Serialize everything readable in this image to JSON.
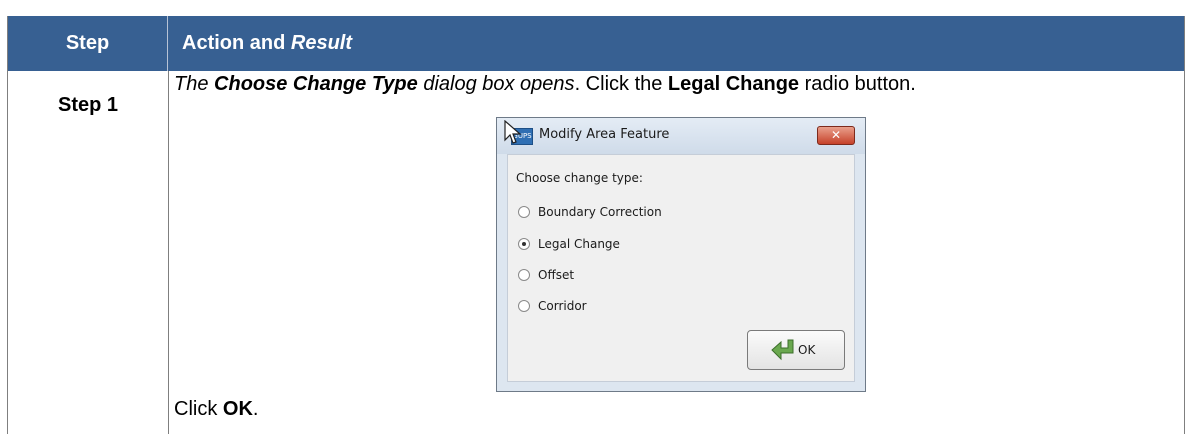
{
  "table": {
    "header": {
      "step": "Step",
      "action_plain": "Action and ",
      "action_italic": "Result"
    },
    "row": {
      "step_label": "Step 1",
      "instruction": {
        "p1": "The ",
        "p2": "Choose Change Type",
        "p3": " dialog box opens",
        "p4": ". Click the ",
        "p5": "Legal Change",
        "p6": " radio button."
      },
      "final": {
        "p1": "Click ",
        "p2": "OK",
        "p3": "."
      }
    }
  },
  "dialog": {
    "title": "Modify Area Feature",
    "app_icon_text": "GUPS",
    "close_symbol": "✕",
    "prompt": "Choose change type:",
    "options": [
      {
        "label": "Boundary Correction",
        "checked": false
      },
      {
        "label": "Legal Change",
        "checked": true
      },
      {
        "label": "Offset",
        "checked": false
      },
      {
        "label": "Corridor",
        "checked": false
      }
    ],
    "ok_label": "OK"
  },
  "colors": {
    "header_bg": "#376092",
    "header_text": "#ffffff"
  }
}
